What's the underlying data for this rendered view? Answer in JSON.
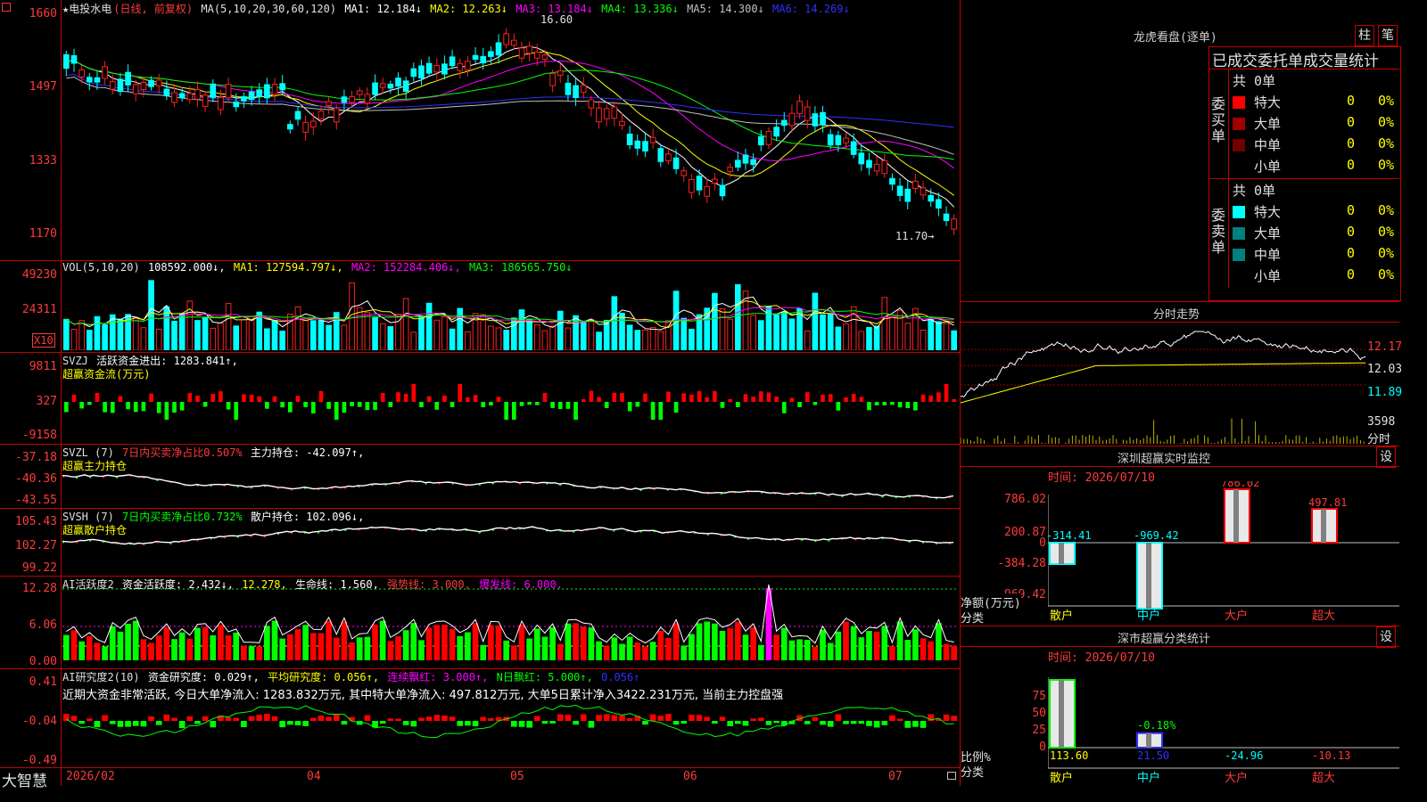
{
  "main": {
    "ticks": [
      "1660",
      "1497",
      "1333",
      "1170"
    ],
    "title": "★电投水电",
    "mode": "(日线, 前复权)",
    "ma_label": "MA(5,10,20,30,60,120)",
    "ma": [
      {
        "text": "MA1: 12.184↓",
        "color": "#ffffff"
      },
      {
        "text": "MA2: 12.263↓",
        "color": "#ffff00"
      },
      {
        "text": "MA3: 13.184↓",
        "color": "#ff00ff"
      },
      {
        "text": "MA4: 13.336↓",
        "color": "#00ff00"
      },
      {
        "text": "MA5: 14.300↓",
        "color": "#c0c0c0"
      },
      {
        "text": "MA6: 14.269↓",
        "color": "#3030ff"
      }
    ],
    "high_label": "16.60",
    "low_label": "11.70→"
  },
  "vol": {
    "ticks": [
      "49230",
      "24311"
    ],
    "unit": "X10",
    "label": "VOL(5,10,20)",
    "val": "108592.000↓,",
    "ma1": "MA1: 127594.797↓,",
    "ma2": "MA2: 152284.406↓,",
    "ma3": "MA3: 186565.750↓"
  },
  "svzj": {
    "ticks": [
      "9811",
      "327",
      "-9158"
    ],
    "label": "SVZJ",
    "text": "活跃资金进出: 1283.841↑,",
    "sub": "超赢资金流(万元)"
  },
  "svzl": {
    "ticks": [
      "-37.18",
      "-40.36",
      "-43.55"
    ],
    "label": "SVZL (7)",
    "ratio": "7日内买卖净占比0.507%",
    "text": "主力持仓: -42.097↑,",
    "sub": "超赢主力持仓"
  },
  "svsh": {
    "ticks": [
      "105.43",
      "102.27",
      "99.22"
    ],
    "label": "SVSH (7)",
    "ratio": "7日内买卖净占比0.732%",
    "text": "散户持仓: 102.096↓,",
    "sub": "超赢散户持仓"
  },
  "ai1": {
    "ticks": [
      "12.28",
      "6.06",
      "0.00"
    ],
    "label": "AI活跃度2",
    "t1": "资金活跃度: 2.432↓,",
    "t2": "12.278,",
    "t3": "生命线: 1.560,",
    "t4": "强势线: 3.000,",
    "t5": "爆发线: 6.000,"
  },
  "ai2": {
    "ticks": [
      "0.41",
      "-0.04",
      "-0.49"
    ],
    "label": "AI研究度2(10)",
    "t1": "资金研究度: 0.029↑,",
    "t2": "平均研究度: 0.056↑,",
    "t3": "连续飘红: 3.000↑,",
    "t4": "N日飘红: 5.000↑,",
    "t5": "0.056↑",
    "comment": "近期大资金非常活跃, 今日大单净流入: 1283.832万元, 其中特大单净流入: 497.812万元, 大单5日累计净入3422.231万元, 当前主力控盘强"
  },
  "xaxis": {
    "brand": "大智慧",
    "labels": [
      "2026/02",
      "04",
      "05",
      "06",
      "07"
    ]
  },
  "lhb": {
    "title": "龙虎看盘(逐单)",
    "btn1": "柱",
    "btn2": "笔",
    "header": "已成交委托单成交量统计",
    "buy_side": "委买单",
    "sell_side": "委卖单",
    "buy_total": "共 0单",
    "sell_total": "共 0单",
    "buy_rows": [
      {
        "name": "特大",
        "count": "0",
        "pct": "0%",
        "color": "#ff0000"
      },
      {
        "name": "大单",
        "count": "0",
        "pct": "0%",
        "color": "#a00000"
      },
      {
        "name": "中单",
        "count": "0",
        "pct": "0%",
        "color": "#700000"
      },
      {
        "name": "小单",
        "count": "0",
        "pct": "0%",
        "color": ""
      }
    ],
    "sell_rows": [
      {
        "name": "特大",
        "count": "0",
        "pct": "0%",
        "color": "#00ffff"
      },
      {
        "name": "大单",
        "count": "0",
        "pct": "0%",
        "color": "#008080"
      },
      {
        "name": "中单",
        "count": "0",
        "pct": "0%",
        "color": "#008080"
      },
      {
        "name": "小单",
        "count": "0",
        "pct": "0%",
        "color": ""
      }
    ]
  },
  "fenshi": {
    "title": "分时走势",
    "p1": "12.17",
    "p2": "12.03",
    "p3": "11.89",
    "v1": "3598",
    "v2": "分时"
  },
  "monitor": {
    "title": "深圳超赢实时监控",
    "btn": "设",
    "time": "时间: 2026/07/10",
    "ticks": [
      "786.02",
      "200.87",
      "0",
      "-384.28",
      "-969.42"
    ],
    "ylabel": "净额(万元)",
    "xlabel": "分类",
    "cats": [
      "散户",
      "中户",
      "大户",
      "超大"
    ],
    "values": [
      -314.41,
      -969.42,
      786.02,
      497.81
    ],
    "value_labels": [
      "-314.41",
      "-969.42",
      "786.02",
      "497.81"
    ]
  },
  "stats": {
    "title": "深市超赢分类统计",
    "btn": "设",
    "time": "时间: 2026/07/10",
    "ticks": [
      "75",
      "50",
      "25",
      "0"
    ],
    "ylabel": "比例%",
    "xlabel": "分类",
    "cats": [
      "散户",
      "中户",
      "大户",
      "超大"
    ],
    "values": [
      113.6,
      21.5,
      -24.96,
      -10.13
    ],
    "value_labels": [
      "113.60",
      "21.50",
      "-24.96",
      "-10.13"
    ],
    "mid_label": "-0.18%"
  },
  "colors": {
    "up": "#ff2020",
    "down": "#00ffff",
    "frame": "#c00000",
    "green": "#00ff00"
  }
}
